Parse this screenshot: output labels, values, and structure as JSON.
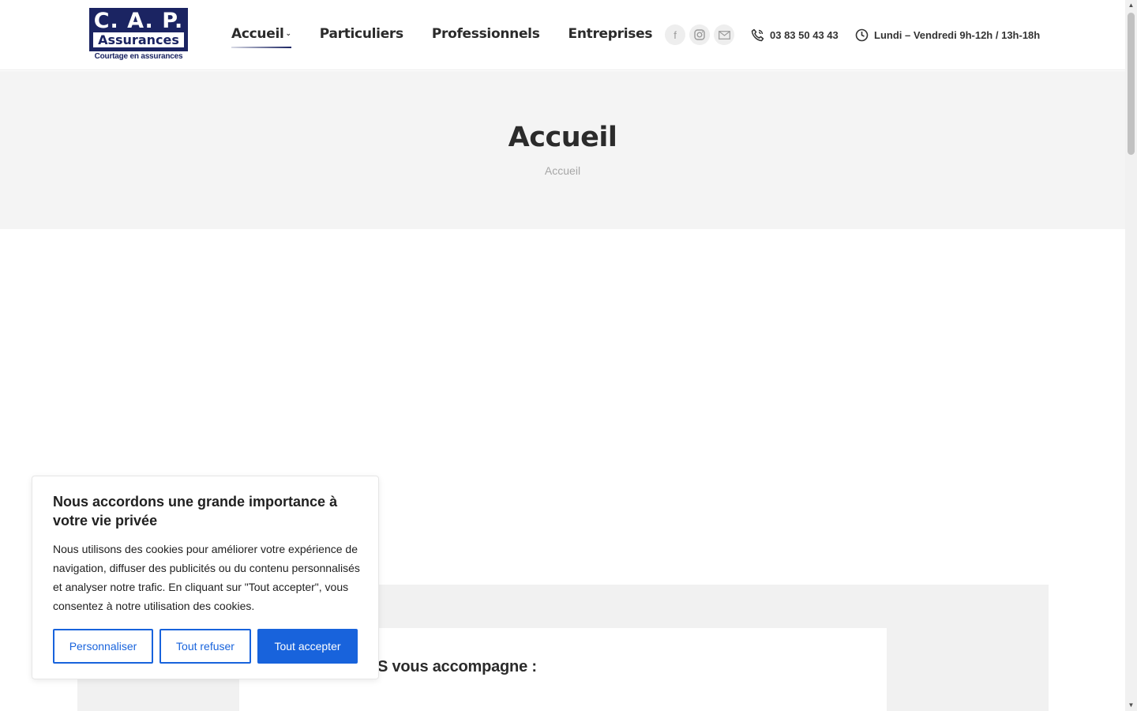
{
  "logo": {
    "top": "C. A. P.",
    "band": "Assurances",
    "sub": "Courtage en assurances"
  },
  "nav": {
    "items": [
      {
        "label": "Accueil"
      },
      {
        "label": "Particuliers"
      },
      {
        "label": "Professionnels"
      },
      {
        "label": "Entreprises"
      }
    ]
  },
  "social": {
    "facebook": "f",
    "instagram": "instagram-icon",
    "mail": "mail-icon"
  },
  "contact": {
    "phone": "03 83 50 43 43",
    "hours": "Lundi – Vendredi 9h-12h / 13h-18h"
  },
  "title_band": {
    "title": "Accueil",
    "breadcrumb": "Accueil"
  },
  "content": {
    "heading_partial": "S vous accompagne :"
  },
  "cookie": {
    "title": "Nous accordons une grande importance à votre vie privée",
    "text": "Nous utilisons des cookies pour améliorer votre expérience de navigation, diffuser des publicités ou du contenu personnalisés et analyser notre trafic. En cliquant sur \"Tout accepter\", vous consentez à notre utilisation des cookies.",
    "btn_customize": "Personnaliser",
    "btn_refuse": "Tout refuser",
    "btn_accept": "Tout accepter"
  },
  "colors": {
    "brand": "#1b2462",
    "cookie_accent": "#1863dc",
    "band": "#f4f4f4"
  }
}
